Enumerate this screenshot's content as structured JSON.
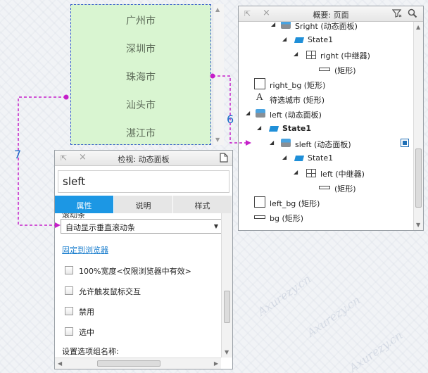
{
  "city_list": {
    "items": [
      "广州市",
      "深圳市",
      "珠海市",
      "汕头市",
      "湛江市"
    ]
  },
  "outline": {
    "title": "概要: 页面",
    "close_glyph": "×",
    "collapse_glyph": "⇱",
    "filter_icon": "filter-icon",
    "search_icon": "search-icon",
    "items": [
      {
        "label": "Sright (动态面板)",
        "icon": "dynamic-panel",
        "expanded": true
      },
      {
        "label": "State1",
        "icon": "state",
        "expanded": true
      },
      {
        "label": "right (中继器)",
        "icon": "repeater",
        "expanded": true
      },
      {
        "label": "(矩形)",
        "icon": "bar"
      },
      {
        "label": "right_bg (矩形)",
        "icon": "rectangle"
      },
      {
        "label": "待选城市 (矩形)",
        "icon": "text"
      },
      {
        "label": "left (动态面板)",
        "icon": "dynamic-panel",
        "expanded": true
      },
      {
        "label": "State1",
        "icon": "state",
        "expanded": true,
        "bold": true
      },
      {
        "label": "sleft (动态面板)",
        "icon": "dynamic-panel",
        "expanded": true
      },
      {
        "label": "State1",
        "icon": "state",
        "expanded": true
      },
      {
        "label": "left (中继器)",
        "icon": "repeater",
        "expanded": true
      },
      {
        "label": "(矩形)",
        "icon": "bar"
      },
      {
        "label": "left_bg (矩形)",
        "icon": "rectangle"
      },
      {
        "label": "bg (矩形)",
        "icon": "bar"
      }
    ]
  },
  "inspector": {
    "title": "检视: 动态面板",
    "close_glyph": "×",
    "collapse_glyph": "⇱",
    "page_icon": "page-icon",
    "widget_name": "sleft",
    "tabs": [
      "属性",
      "说明",
      "样式"
    ],
    "active_tab": "属性",
    "cut_label": "滚动条",
    "scroll_select": "自动显示垂直滚动条",
    "pin_link": "固定到浏览器",
    "checkboxes": [
      {
        "label": "100%宽度<仅限浏览器中有效>",
        "checked": false
      },
      {
        "label": "允许触发鼠标交互",
        "checked": false
      },
      {
        "label": "禁用",
        "checked": false
      },
      {
        "label": "选中",
        "checked": false
      }
    ],
    "group_label": "设置选项组名称:"
  },
  "annotations": {
    "six": "6",
    "seven": "7",
    "color": "#c51fc9"
  },
  "watermark": "Axurezy.cn"
}
